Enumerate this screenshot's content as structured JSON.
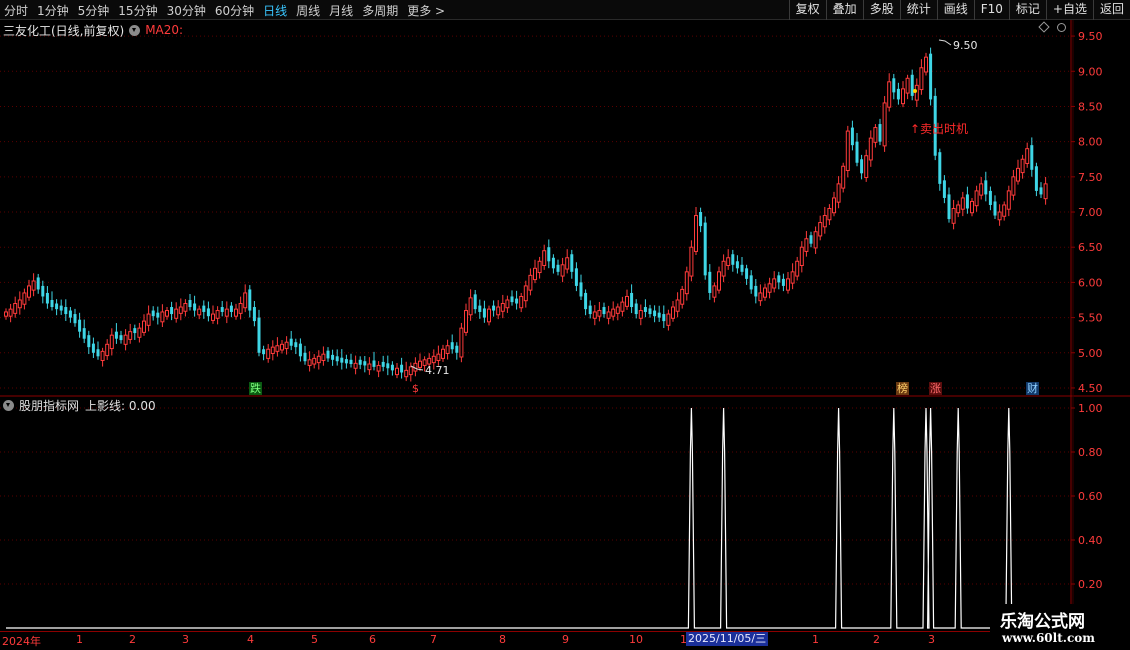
{
  "toolbar": {
    "periods": [
      "分时",
      "1分钟",
      "5分钟",
      "15分钟",
      "30分钟",
      "60分钟",
      "日线",
      "周线",
      "月线",
      "多周期",
      "更多 >"
    ],
    "active_period": "日线",
    "actions": [
      "复权",
      "叠加",
      "多股",
      "统计",
      "画线",
      "F10",
      "标记",
      "+自选",
      "返回"
    ]
  },
  "price_panel": {
    "stock_name": "三友化工(日线,前复权)",
    "ma_label": "MA20:",
    "high_label": "9.50",
    "low_label": "4.71",
    "annotation": "↑卖出时机",
    "markers": {
      "die": "跌",
      "s": "$",
      "bang": "榜",
      "zhang": "涨",
      "cai": "财"
    }
  },
  "indicator_panel": {
    "name": "股朋指标网",
    "line_label": "上影线: 0.00"
  },
  "date_axis": {
    "labels": [
      "2024年",
      "1",
      "2",
      "3",
      "4",
      "5",
      "6",
      "7",
      "8",
      "9",
      "10",
      "1",
      "1",
      "2",
      "3"
    ],
    "highlight": "2025/11/05/三"
  },
  "watermark": {
    "title": "乐淘公式网",
    "url": "www.60lt.com"
  },
  "colors": {
    "up": "#ff3b3b",
    "down": "#3fd6e6",
    "grid": "#5a0000",
    "axis": "#8b0000",
    "signal": "#ffffff"
  },
  "chart_data": [
    {
      "type": "candlestick",
      "title": "三友化工(日线,前复权)",
      "ylim": [
        4.4,
        9.7
      ],
      "yticks": [
        4.5,
        5.0,
        5.5,
        6.0,
        6.5,
        7.0,
        7.5,
        8.0,
        8.5,
        9.0,
        9.5
      ],
      "ytick_labels": [
        "4.50",
        "5.00",
        "5.50",
        "6.00",
        "6.50",
        "7.00",
        "7.50",
        "8.00",
        "8.50",
        "9.00",
        "9.50"
      ],
      "grid": true,
      "annotations": [
        {
          "text": "9.50",
          "value": 9.5,
          "kind": "high"
        },
        {
          "text": "4.71",
          "value": 4.71,
          "kind": "low"
        }
      ],
      "close": [
        5.58,
        5.62,
        5.7,
        5.75,
        5.85,
        5.95,
        6.02,
        5.9,
        5.8,
        5.7,
        5.65,
        5.62,
        5.6,
        5.55,
        5.5,
        5.42,
        5.3,
        5.2,
        5.08,
        5.0,
        4.95,
        5.02,
        5.12,
        5.25,
        5.2,
        5.18,
        5.25,
        5.3,
        5.28,
        5.35,
        5.45,
        5.55,
        5.52,
        5.5,
        5.58,
        5.6,
        5.55,
        5.62,
        5.65,
        5.7,
        5.65,
        5.6,
        5.62,
        5.58,
        5.52,
        5.55,
        5.6,
        5.58,
        5.62,
        5.58,
        5.62,
        5.7,
        5.85,
        5.6,
        5.45,
        5.0,
        4.98,
        5.05,
        5.08,
        5.1,
        5.12,
        5.15,
        5.1,
        5.08,
        4.95,
        4.88,
        4.9,
        4.92,
        4.95,
        4.98,
        4.92,
        4.9,
        4.88,
        4.86,
        4.85,
        4.84,
        4.85,
        4.83,
        4.82,
        4.84,
        4.8,
        4.82,
        4.8,
        4.78,
        4.75,
        4.78,
        4.72,
        4.75,
        4.8,
        4.85,
        4.88,
        4.9,
        4.92,
        4.95,
        4.98,
        5.05,
        5.1,
        5.05,
        5.0,
        5.35,
        5.6,
        5.78,
        5.62,
        5.58,
        5.5,
        5.62,
        5.6,
        5.65,
        5.7,
        5.75,
        5.72,
        5.7,
        5.8,
        5.95,
        6.1,
        6.2,
        6.3,
        6.45,
        6.3,
        6.2,
        6.15,
        6.25,
        6.35,
        6.15,
        5.95,
        5.8,
        5.62,
        5.55,
        5.58,
        5.6,
        5.55,
        5.58,
        5.62,
        5.65,
        5.72,
        5.8,
        5.65,
        5.55,
        5.6,
        5.58,
        5.55,
        5.52,
        5.5,
        5.45,
        5.55,
        5.65,
        5.75,
        5.9,
        6.15,
        6.5,
        6.95,
        6.8,
        6.1,
        5.85,
        5.95,
        6.15,
        6.3,
        6.35,
        6.25,
        6.2,
        6.15,
        6.05,
        5.9,
        5.8,
        5.85,
        5.92,
        5.98,
        6.05,
        6.0,
        5.95,
        6.05,
        6.15,
        6.3,
        6.5,
        6.62,
        6.55,
        6.72,
        6.85,
        6.95,
        7.05,
        7.2,
        7.4,
        7.65,
        8.15,
        7.95,
        7.7,
        7.55,
        7.8,
        8.05,
        8.2,
        8.0,
        8.55,
        8.85,
        8.7,
        8.6,
        8.75,
        8.9,
        8.65,
        8.8,
        9.05,
        9.2,
        8.6,
        7.8,
        7.4,
        7.2,
        6.9,
        7.05,
        7.1,
        7.2,
        7.05,
        7.15,
        7.3,
        7.4,
        7.25,
        7.1,
        6.95,
        7.0,
        7.1,
        7.3,
        7.5,
        7.62,
        7.75,
        7.9,
        7.6,
        7.3,
        7.25,
        7.4
      ],
      "up": [
        1,
        1,
        1,
        1,
        1,
        1,
        1,
        0,
        0,
        0,
        0,
        0,
        0,
        0,
        0,
        0,
        0,
        0,
        0,
        0,
        0,
        1,
        1,
        1,
        0,
        0,
        1,
        1,
        0,
        1,
        1,
        1,
        0,
        0,
        1,
        1,
        0,
        1,
        1,
        1,
        0,
        0,
        1,
        0,
        0,
        1,
        1,
        0,
        1,
        0,
        1,
        1,
        1,
        0,
        0,
        0,
        0,
        1,
        1,
        1,
        1,
        1,
        0,
        0,
        0,
        0,
        1,
        1,
        1,
        1,
        0,
        0,
        0,
        0,
        0,
        0,
        1,
        0,
        0,
        1,
        0,
        1,
        0,
        0,
        0,
        1,
        0,
        1,
        1,
        1,
        1,
        1,
        1,
        1,
        1,
        1,
        1,
        0,
        0,
        1,
        1,
        1,
        0,
        0,
        0,
        1,
        0,
        1,
        1,
        1,
        0,
        0,
        1,
        1,
        1,
        1,
        1,
        1,
        0,
        0,
        0,
        1,
        1,
        0,
        0,
        0,
        0,
        0,
        1,
        1,
        0,
        1,
        1,
        1,
        1,
        1,
        0,
        0,
        1,
        0,
        0,
        0,
        0,
        0,
        1,
        1,
        1,
        1,
        1,
        1,
        1,
        0,
        0,
        0,
        1,
        1,
        1,
        1,
        0,
        0,
        0,
        0,
        0,
        0,
        1,
        1,
        1,
        1,
        0,
        0,
        1,
        1,
        1,
        1,
        1,
        0,
        1,
        1,
        1,
        1,
        1,
        1,
        1,
        1,
        0,
        0,
        0,
        1,
        1,
        1,
        0,
        1,
        1,
        0,
        0,
        1,
        1,
        0,
        1,
        1,
        1,
        0,
        0,
        0,
        0,
        0,
        1,
        1,
        1,
        0,
        1,
        1,
        1,
        0,
        0,
        0,
        1,
        1,
        1,
        1,
        1,
        1,
        1,
        0,
        0,
        0,
        1
      ]
    },
    {
      "type": "line",
      "title": "股朋指标网",
      "series": [
        {
          "name": "上影线",
          "values": []
        }
      ],
      "ylim": [
        0,
        1.05
      ],
      "yticks": [
        0.2,
        0.4,
        0.6,
        0.8,
        1.0
      ],
      "ytick_labels": [
        "0.20",
        "0.40",
        "0.60",
        "0.80",
        "1.00"
      ],
      "current_value": 0.0,
      "pulse_bars": [
        149,
        156,
        181,
        193,
        200,
        201,
        207,
        218
      ],
      "total_bars": 230
    }
  ]
}
